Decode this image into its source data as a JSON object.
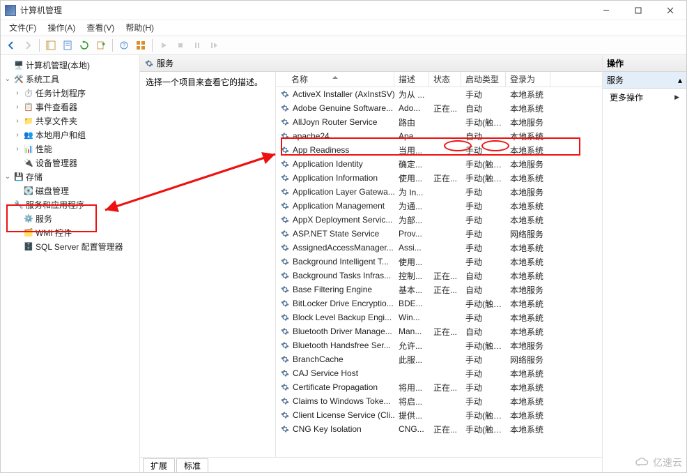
{
  "window": {
    "title": "计算机管理"
  },
  "menu": {
    "file": "文件(F)",
    "action": "操作(A)",
    "view": "查看(V)",
    "help": "帮助(H)"
  },
  "tree": {
    "root": "计算机管理(本地)",
    "system_tools": "系统工具",
    "task_scheduler": "任务计划程序",
    "event_viewer": "事件查看器",
    "shared_folders": "共享文件夹",
    "local_users": "本地用户和组",
    "performance": "性能",
    "device_manager": "设备管理器",
    "storage": "存储",
    "disk_mgmt": "磁盘管理",
    "services_apps": "服务和应用程序",
    "services": "服务",
    "wmi": "WMI 控件",
    "sqlserver": "SQL Server 配置管理器"
  },
  "center": {
    "header": "服务",
    "desc_prompt": "选择一个项目来查看它的描述。",
    "columns": {
      "name": "名称",
      "desc": "描述",
      "status": "状态",
      "type": "启动类型",
      "logon": "登录为"
    },
    "tabs": {
      "ext": "扩展",
      "std": "标准"
    }
  },
  "right": {
    "header": "操作",
    "sub": "服务",
    "more": "更多操作"
  },
  "watermark": "亿速云",
  "services": [
    {
      "name": "ActiveX Installer (AxInstSV)",
      "desc": "为从 ...",
      "status": "",
      "type": "手动",
      "logon": "本地系统"
    },
    {
      "name": "Adobe Genuine Software...",
      "desc": "Ado...",
      "status": "正在...",
      "type": "自动",
      "logon": "本地系统"
    },
    {
      "name": "AllJoyn Router Service",
      "desc": "路由",
      "status": "",
      "type": "手动(触发...",
      "logon": "本地服务"
    },
    {
      "name": "apache24",
      "desc": "Apa...",
      "status": "",
      "type": "自动",
      "logon": "本地系统"
    },
    {
      "name": "App Readiness",
      "desc": "当用...",
      "status": "",
      "type": "手动",
      "logon": "本地系统"
    },
    {
      "name": "Application Identity",
      "desc": "确定...",
      "status": "",
      "type": "手动(触发...",
      "logon": "本地服务"
    },
    {
      "name": "Application Information",
      "desc": "使用...",
      "status": "正在...",
      "type": "手动(触发...",
      "logon": "本地系统"
    },
    {
      "name": "Application Layer Gatewa...",
      "desc": "为 In...",
      "status": "",
      "type": "手动",
      "logon": "本地服务"
    },
    {
      "name": "Application Management",
      "desc": "为通...",
      "status": "",
      "type": "手动",
      "logon": "本地系统"
    },
    {
      "name": "AppX Deployment Servic...",
      "desc": "为部...",
      "status": "",
      "type": "手动",
      "logon": "本地系统"
    },
    {
      "name": "ASP.NET State Service",
      "desc": "Prov...",
      "status": "",
      "type": "手动",
      "logon": "网络服务"
    },
    {
      "name": "AssignedAccessManager...",
      "desc": "Assi...",
      "status": "",
      "type": "手动",
      "logon": "本地系统"
    },
    {
      "name": "Background Intelligent T...",
      "desc": "使用...",
      "status": "",
      "type": "手动",
      "logon": "本地系统"
    },
    {
      "name": "Background Tasks Infras...",
      "desc": "控制...",
      "status": "正在...",
      "type": "自动",
      "logon": "本地系统"
    },
    {
      "name": "Base Filtering Engine",
      "desc": "基本...",
      "status": "正在...",
      "type": "自动",
      "logon": "本地服务"
    },
    {
      "name": "BitLocker Drive Encryptio...",
      "desc": "BDE...",
      "status": "",
      "type": "手动(触发...",
      "logon": "本地系统"
    },
    {
      "name": "Block Level Backup Engi...",
      "desc": "Win...",
      "status": "",
      "type": "手动",
      "logon": "本地系统"
    },
    {
      "name": "Bluetooth Driver Manage...",
      "desc": "Man...",
      "status": "正在...",
      "type": "自动",
      "logon": "本地系统"
    },
    {
      "name": "Bluetooth Handsfree Ser...",
      "desc": "允许...",
      "status": "",
      "type": "手动(触发...",
      "logon": "本地服务"
    },
    {
      "name": "BranchCache",
      "desc": "此服...",
      "status": "",
      "type": "手动",
      "logon": "网络服务"
    },
    {
      "name": "CAJ Service Host",
      "desc": "",
      "status": "",
      "type": "手动",
      "logon": "本地系统"
    },
    {
      "name": "Certificate Propagation",
      "desc": "将用...",
      "status": "正在...",
      "type": "手动",
      "logon": "本地系统"
    },
    {
      "name": "Claims to Windows Toke...",
      "desc": "将启...",
      "status": "",
      "type": "手动",
      "logon": "本地系统"
    },
    {
      "name": "Client License Service (Cli...",
      "desc": "提供...",
      "status": "",
      "type": "手动(触发...",
      "logon": "本地系统"
    },
    {
      "name": "CNG Key Isolation",
      "desc": "CNG...",
      "status": "正在...",
      "type": "手动(触发...",
      "logon": "本地系统"
    }
  ]
}
